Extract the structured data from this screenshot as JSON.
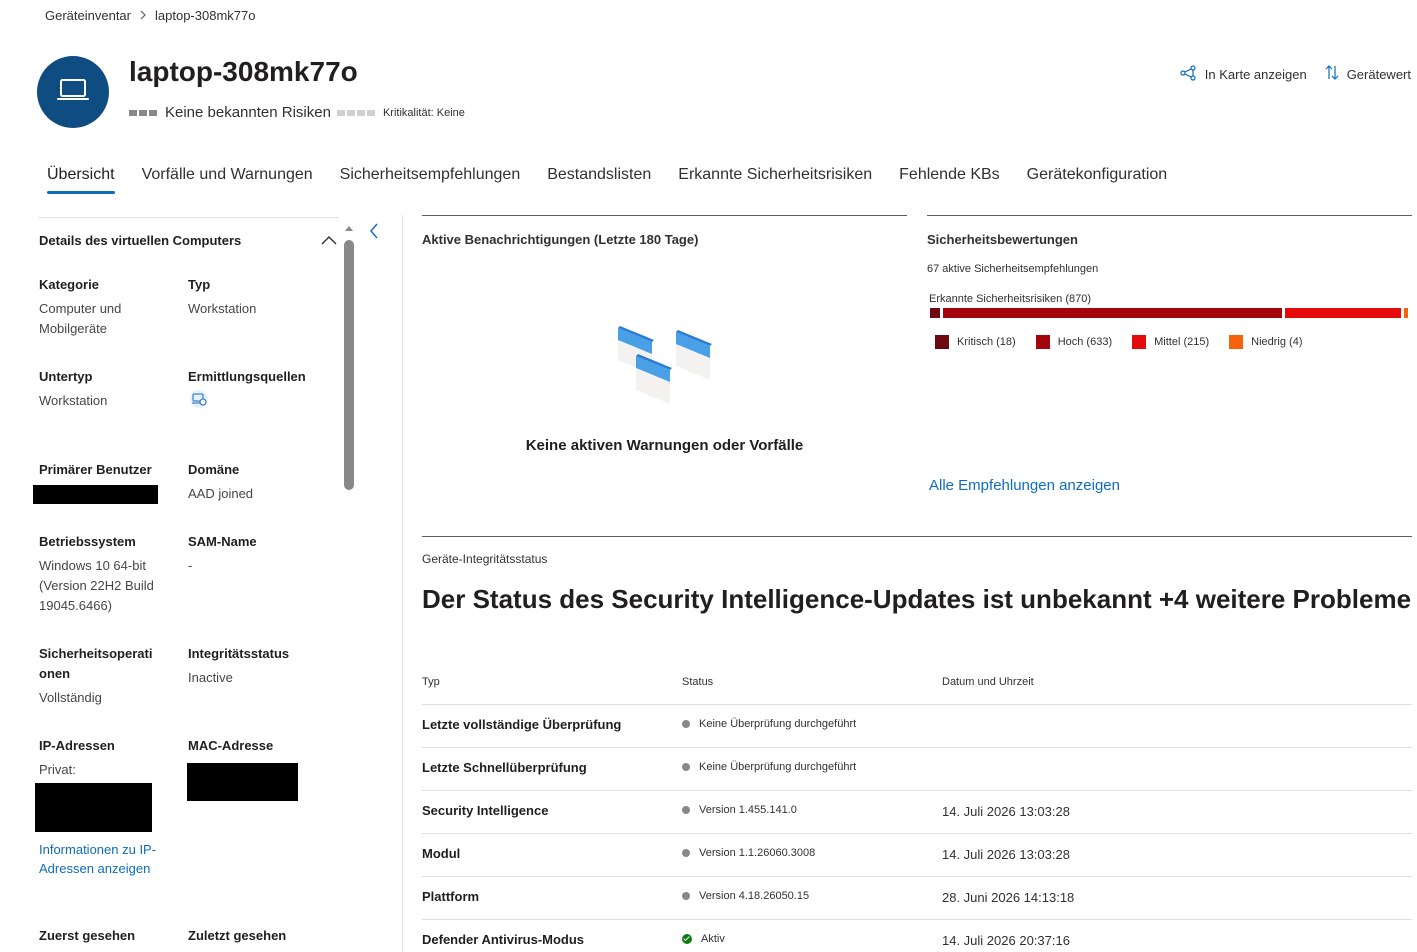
{
  "breadcrumb": {
    "parent": "Geräteinventar",
    "current": "laptop-308mk77o"
  },
  "header": {
    "device_name": "laptop-308mk77o",
    "risk_text": "Keine bekannten Risiken",
    "criticality_text": "Kritikalität: Keine",
    "icon": "laptop-icon",
    "actions": [
      {
        "label": "In Karte anzeigen",
        "icon": "map-graph-icon"
      },
      {
        "label": "Gerätewert",
        "icon": "sort-arrows-icon"
      }
    ]
  },
  "tabs": [
    {
      "label": "Übersicht",
      "active": true
    },
    {
      "label": "Vorfälle und Warnungen"
    },
    {
      "label": "Sicherheitsempfehlungen"
    },
    {
      "label": "Bestandslisten"
    },
    {
      "label": "Erkannte Sicherheitsrisiken"
    },
    {
      "label": "Fehlende KBs"
    },
    {
      "label": "Gerätekonfiguration"
    }
  ],
  "left_panel": {
    "title": "Details des virtuellen Computers",
    "fields": {
      "kategorie": {
        "label": "Kategorie",
        "value": "Computer und Mobilgeräte"
      },
      "typ": {
        "label": "Typ",
        "value": "Workstation"
      },
      "untertyp": {
        "label": "Untertyp",
        "value": "Workstation"
      },
      "ermittlungsquelle": {
        "label": "Ermittlungsquellen",
        "icon": "discovery-source-icon"
      },
      "primaerer_benutzer": {
        "label": "Primärer Benutzer"
      },
      "domaene": {
        "label": "Domäne",
        "value": "AAD joined"
      },
      "betriebssystem": {
        "label": "Betriebssystem",
        "value": "Windows 10 64-bit (Version 22H2 Build 19045.6466)"
      },
      "sam_name": {
        "label": "SAM-Name",
        "value": "-"
      },
      "sicherheitsoperationen": {
        "label": "Sicherheitsoperationen",
        "value": "Vollständig"
      },
      "integritaetsstatus": {
        "label": "Integritätsstatus",
        "value": "Inactive"
      },
      "ip_adressen": {
        "label": "IP-Adressen",
        "value": "Privat:",
        "link": "Informationen zu IP-Adressen anzeigen"
      },
      "mac_adresse": {
        "label": "MAC-Adresse"
      },
      "zuerst_gesehen": {
        "label": "Zuerst gesehen"
      },
      "zuletzt_gesehen": {
        "label": "Zuletzt gesehen"
      }
    }
  },
  "alerts_card": {
    "title": "Aktive Benachrichtigungen (Letzte 180 Tage)",
    "empty_text": "Keine aktiven Warnungen oder Vorfälle"
  },
  "security_card": {
    "title": "Sicherheitsbewertungen",
    "active_recs": "67 aktive Sicherheitsempfehlungen",
    "risks_label": "Erkannte Sicherheitsrisiken (870)",
    "risk_total": 870,
    "severities": [
      {
        "label": "Kritisch (18)",
        "count": 18,
        "color": "#6e0811"
      },
      {
        "label": "Hoch (633)",
        "count": 633,
        "color": "#a4040b"
      },
      {
        "label": "Mittel (215)",
        "count": 215,
        "color": "#e60b0b"
      },
      {
        "label": "Niedrig (4)",
        "count": 4,
        "color": "#f7630c"
      }
    ],
    "link": "Alle Empfehlungen anzeigen"
  },
  "health": {
    "section_label": "Geräte-Integritätsstatus",
    "headline": "Der Status des Security Intelligence-Updates ist unbekannt +4 weitere Probleme",
    "columns": [
      "Typ",
      "Status",
      "Datum und Uhrzeit"
    ],
    "rows": [
      {
        "type": "Letzte vollständige Überprüfung",
        "status": "Keine Überprüfung durchgeführt",
        "date": ""
      },
      {
        "type": "Letzte Schnellüberprüfung",
        "status": "Keine Überprüfung durchgeführt",
        "date": ""
      },
      {
        "type": "Security Intelligence",
        "status": "Version 1.455.141.0",
        "date": "14. Juli 2026 13:03:28"
      },
      {
        "type": "Modul",
        "status": "Version 1.1.26060.3008",
        "date": "14. Juli 2026 13:03:28"
      },
      {
        "type": "Plattform",
        "status": "Version 4.18.26050.15",
        "date": "28. Juni 2026 14:13:18"
      },
      {
        "type": "Defender Antivirus-Modus",
        "status": "Aktiv",
        "date": "14. Juli 2026 20:37:16",
        "ok": true
      }
    ]
  }
}
